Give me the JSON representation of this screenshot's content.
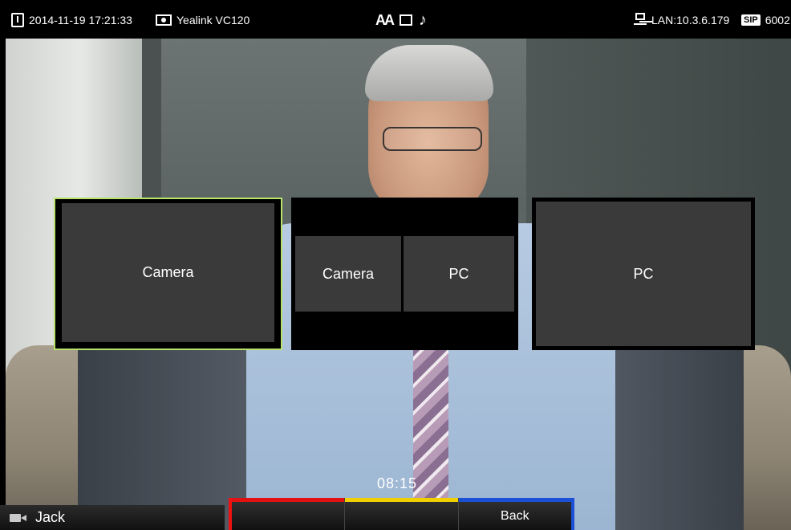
{
  "status": {
    "datetime": "2014-11-19 17:21:33",
    "device": "Yealink VC120",
    "center_icons": [
      "font-size-icon",
      "screen-icon",
      "music-note-icon"
    ],
    "center_icon_glyph": "AA",
    "network": "LAN:10.3.6.179",
    "sip_badge": "SIP",
    "sip_account": "6002"
  },
  "layouts": [
    {
      "label": "Camera",
      "selected": true
    },
    {
      "left": "Camera",
      "right": "PC"
    },
    {
      "label": "PC",
      "selected": false
    }
  ],
  "timer": "08:15",
  "participant": {
    "name": "Jack",
    "icon": "camera-icon"
  },
  "softkeys": [
    {
      "label": "",
      "color": "#e11111"
    },
    {
      "label": "",
      "color": "#f0d000"
    },
    {
      "label": "Back",
      "color": "#1b4fd6"
    }
  ],
  "colors": {
    "selected_border": "#b7e36a",
    "tile_bg": "#3a3a3a",
    "status_bg": "#000000"
  }
}
